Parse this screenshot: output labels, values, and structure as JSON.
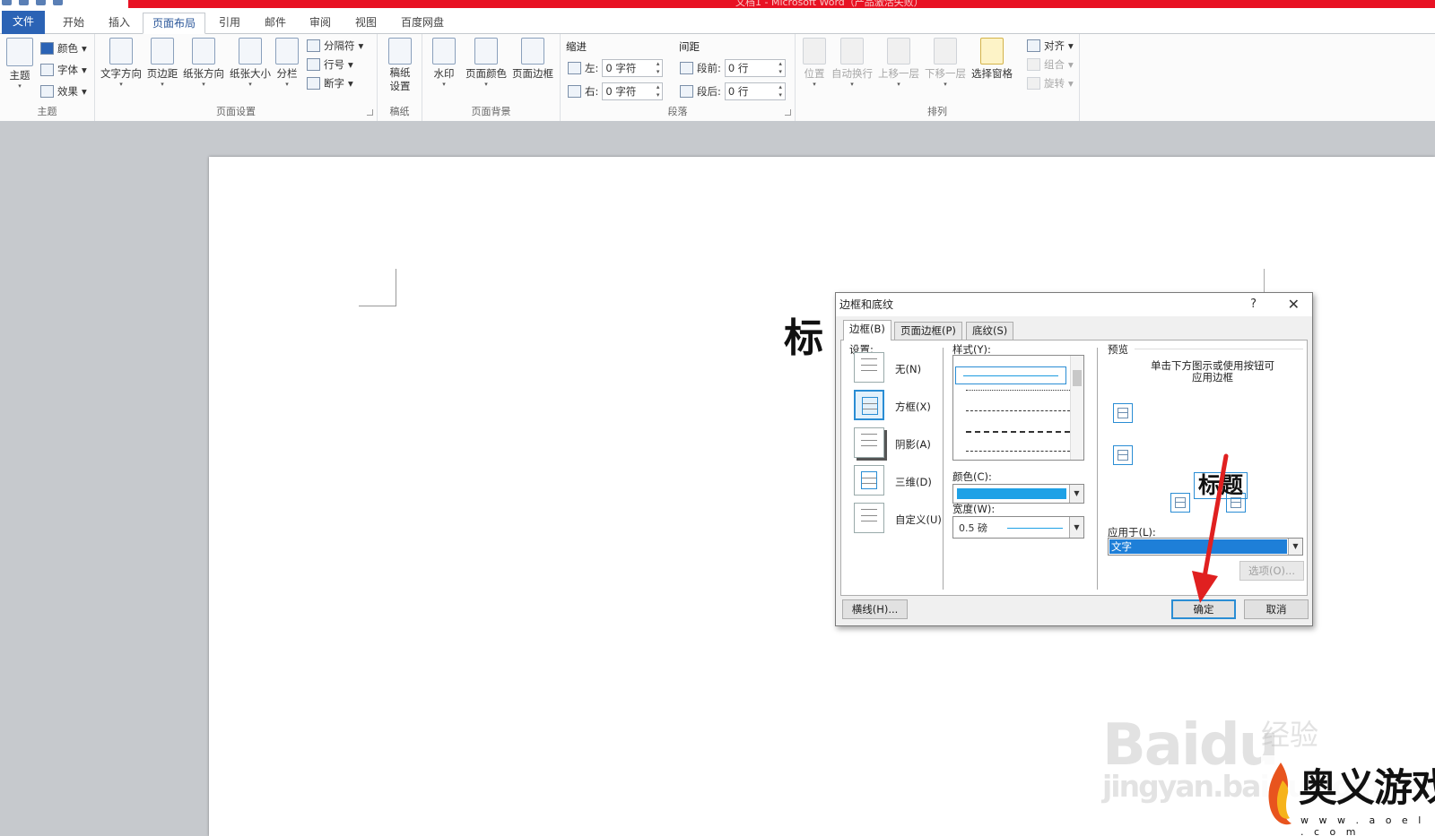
{
  "window": {
    "title": "文档1 - Microsoft Word（产品激活失败）"
  },
  "tabs": [
    "文件",
    "开始",
    "插入",
    "页面布局",
    "引用",
    "邮件",
    "审阅",
    "视图",
    "百度网盘"
  ],
  "ribbon": {
    "theme": {
      "main": "主题",
      "colors": "颜色",
      "fonts": "字体",
      "effects": "效果",
      "group": "主题"
    },
    "page_setup": {
      "text_direction": "文字方向",
      "margins": "页边距",
      "orientation": "纸张方向",
      "size": "纸张大小",
      "columns": "分栏",
      "breaks": "分隔符",
      "line_numbers": "行号",
      "hyphenation": "断字",
      "group": "页面设置"
    },
    "manuscript": {
      "setup": "稿纸\n设置",
      "group": "稿纸"
    },
    "page_background": {
      "watermark": "水印",
      "page_color": "页面颜色",
      "page_borders": "页面边框",
      "group": "页面背景"
    },
    "paragraph": {
      "indent_label": "缩进",
      "spacing_label": "间距",
      "left": "左:",
      "right": "右:",
      "before": "段前:",
      "after": "段后:",
      "left_value": "0 字符",
      "right_value": "0 字符",
      "before_value": "0 行",
      "after_value": "0 行",
      "group": "段落"
    },
    "arrange": {
      "position": "位置",
      "wrap": "自动换行",
      "bring_forward": "上移一层",
      "send_backward": "下移一层",
      "selection_pane": "选择窗格",
      "align": "对齐",
      "group_obj": "组合",
      "rotate": "旋转",
      "group": "排列"
    }
  },
  "document": {
    "heading_text": "标"
  },
  "dialog": {
    "title": "边框和底纹",
    "help": "?",
    "close": "✕",
    "tabs": [
      "边框(B)",
      "页面边框(P)",
      "底纹(S)"
    ],
    "settings_label": "设置:",
    "settings": [
      "无(N)",
      "方框(X)",
      "阴影(A)",
      "三维(D)",
      "自定义(U)"
    ],
    "style_label": "样式(Y):",
    "color_label": "颜色(C):",
    "color_value": "#1ea1e6",
    "width_label": "宽度(W):",
    "width_value": "0.5 磅",
    "preview_label": "预览",
    "preview_hint": "单击下方图示或使用按钮可\n应用边框",
    "preview_word": "标题",
    "apply_label": "应用于(L):",
    "apply_value": "文字",
    "options_button": "选项(O)...",
    "horizontal_line_button": "横线(H)...",
    "ok_button": "确定",
    "cancel_button": "取消"
  },
  "watermark": {
    "brand": "Baidu",
    "brand_cn": "经验",
    "url": "jingyan.baidu.com"
  },
  "site_logo": {
    "name": "奥义游戏网",
    "url": "w w w . a o e l . c o m"
  },
  "colors": {
    "accent": "#2b63b5",
    "title_red": "#e81123",
    "selection_blue": "#1e7fd8",
    "annotation_arrow": "#e02020"
  }
}
